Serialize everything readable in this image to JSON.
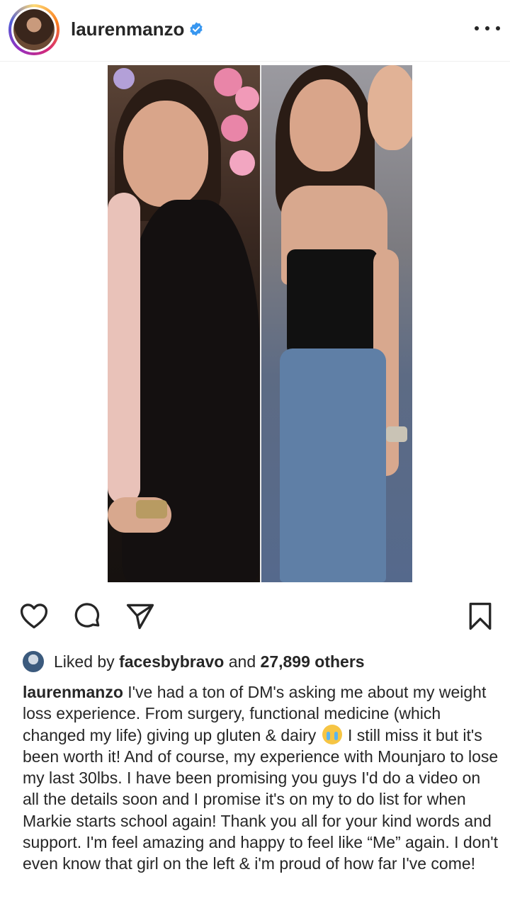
{
  "header": {
    "username": "laurenmanzo",
    "verified": true,
    "more_icon": "more-horizontal-icon"
  },
  "post": {
    "image_description_icon": "photo"
  },
  "actions": {
    "like_icon": "heart-icon",
    "comment_icon": "comment-icon",
    "share_icon": "paper-plane-icon",
    "save_icon": "bookmark-icon"
  },
  "likes": {
    "prefix": "Liked by ",
    "user": "facesbybravo",
    "middle": " and ",
    "count": "27,899 others"
  },
  "caption": {
    "author": "laurenmanzo",
    "text_before_emoji": " I've had a ton of DM's asking me about my weight loss experience. From surgery, functional medicine (which changed my life) giving up gluten & dairy",
    "emoji": "loudly-crying-face",
    "text_after_emoji": " I still miss it but it's been worth it! And of course, my experience with Mounjaro to lose my last 30lbs. I have been promising you guys I'd do a video on all the details soon and I promise it's on my to do list for when Markie starts school again! Thank you all for your kind words and support. I'm feel amazing and happy to feel like “Me” again. I don't even know that girl on the left & i'm proud of how far I've come!"
  },
  "colors": {
    "text": "#262626",
    "verified_blue": "#3897f0",
    "divider": "#efefef"
  }
}
